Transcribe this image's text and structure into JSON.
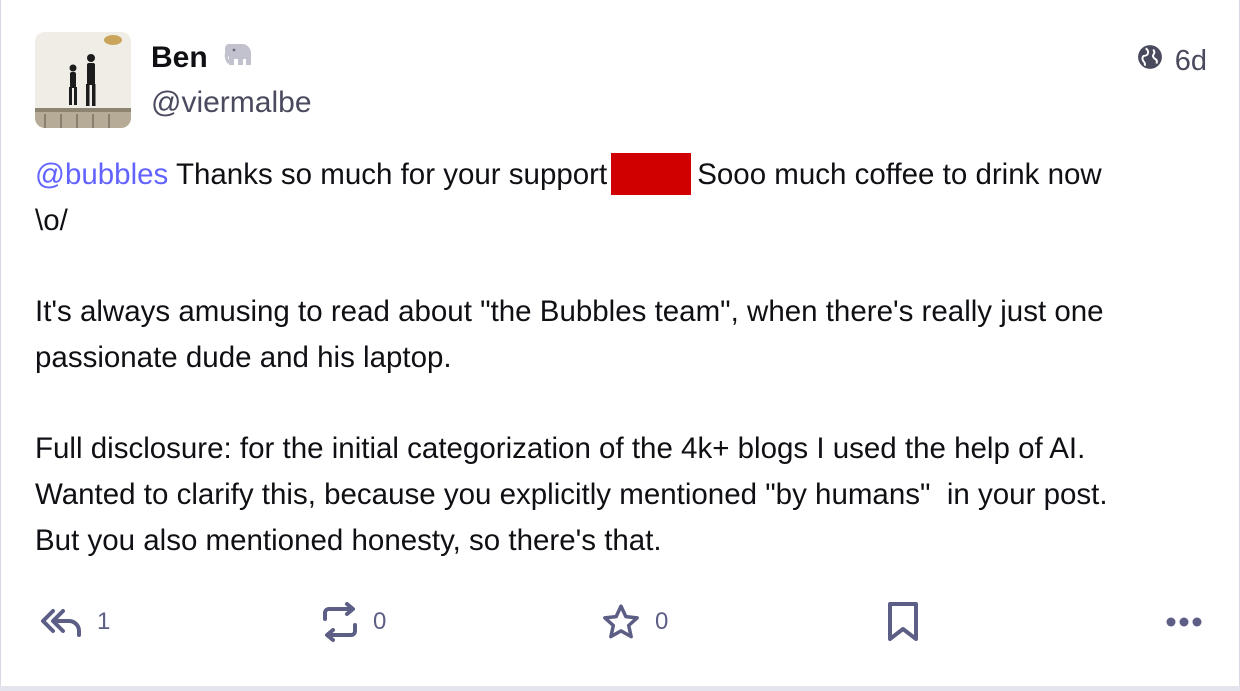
{
  "author": {
    "name": "Ben",
    "badge_icon": "elephant-icon",
    "handle": "@viermalbe"
  },
  "meta": {
    "visibility_icon": "globe-icon",
    "time": "6d"
  },
  "content": {
    "mention": "@bubbles",
    "p1_a": "Thanks so much for your support",
    "p1_b": "Sooo much coffee to drink now\n\\o/",
    "p2": "It's always amusing to read about \"the Bubbles team\", when there's really just one passionate dude and his laptop.",
    "p3": "Full disclosure: for the initial categorization of the 4k+ blogs I used the help of AI.\nWanted to clarify this, because you explicitly mentioned \"by humans\"  in your post.\nBut you also mentioned honesty, so there's that."
  },
  "actions": {
    "reply_count": "1",
    "boost_count": "0",
    "favourite_count": "0"
  },
  "colors": {
    "accent": "#6364ff",
    "icon": "#5d5e85",
    "redaction": "#d10000"
  }
}
